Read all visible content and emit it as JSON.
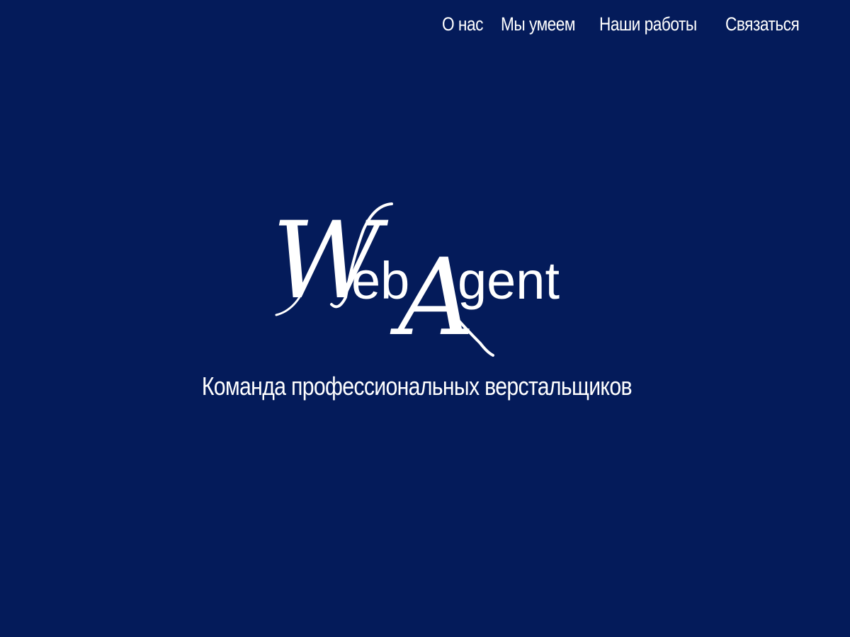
{
  "nav": {
    "items": [
      {
        "label": "О нас"
      },
      {
        "label": "Мы умеем"
      },
      {
        "label": "Наши работы"
      },
      {
        "label": "Связаться"
      }
    ]
  },
  "hero": {
    "logo": {
      "wordmark": "WebAgent",
      "part1": "W",
      "part2": "eb",
      "part3": "A",
      "part4": "gent"
    },
    "tagline": "Команда профессиональных верстальщиков"
  },
  "colors": {
    "background": "#041b5a",
    "text": "#ffffff"
  }
}
